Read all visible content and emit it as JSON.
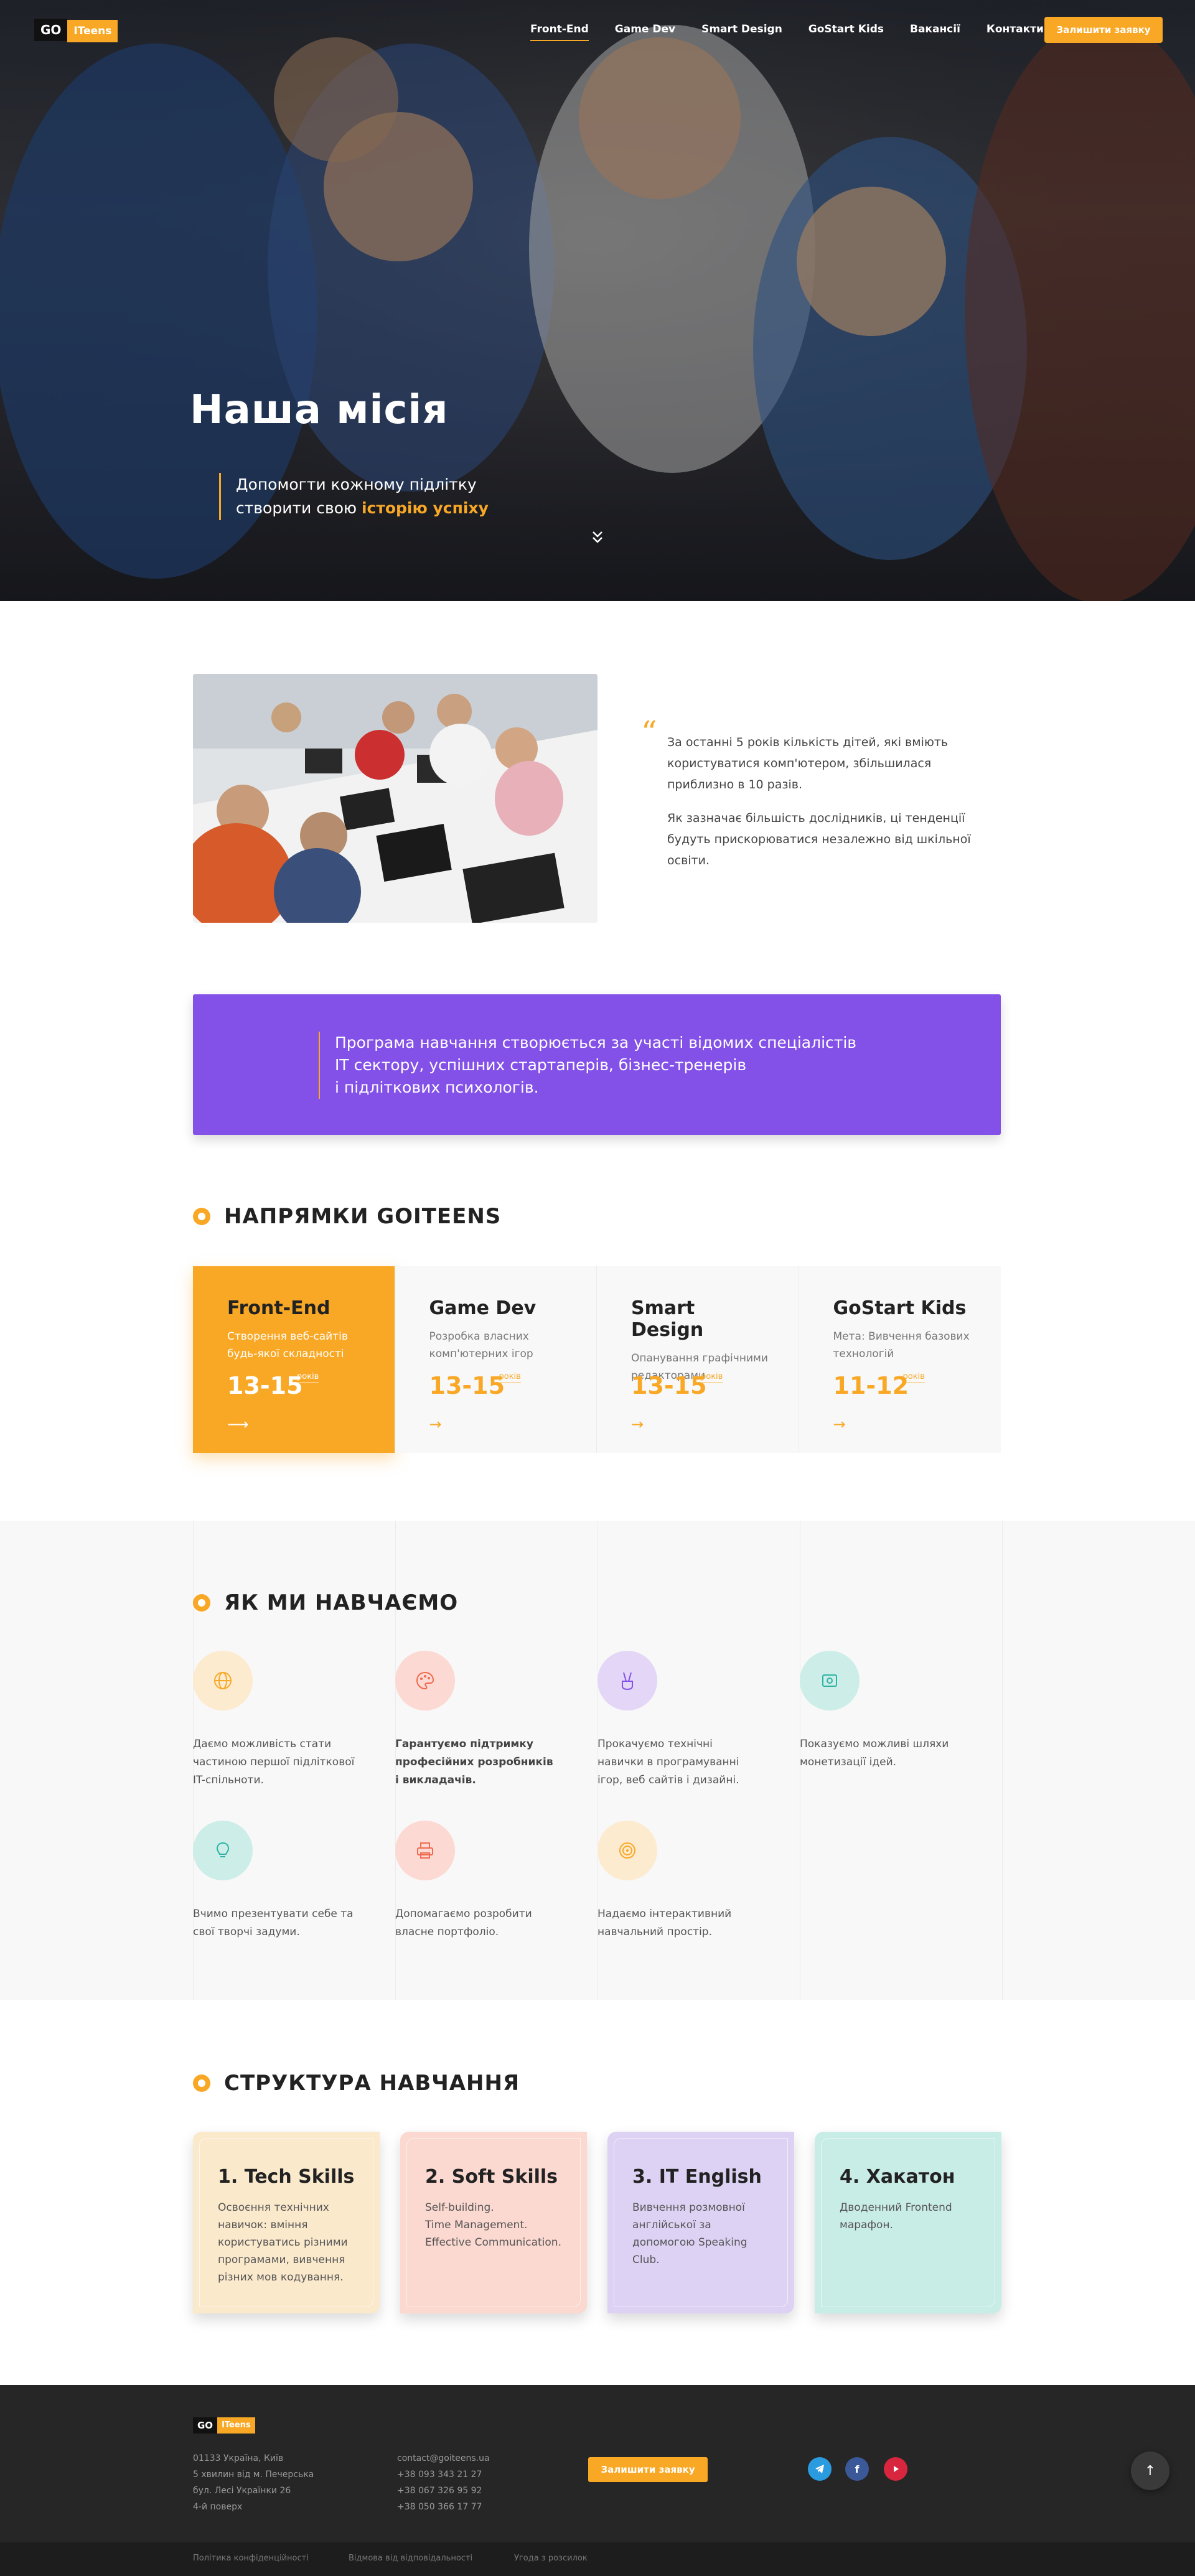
{
  "nav": {
    "logo_go": "GO",
    "logo_teens": "ITeens",
    "items": [
      {
        "label": "Front-End"
      },
      {
        "label": "Game Dev"
      },
      {
        "label": "Smart Design"
      },
      {
        "label": "GoStart Kids"
      },
      {
        "label": "Вакансії"
      },
      {
        "label": "Контакти"
      }
    ],
    "active_index": 0,
    "cta": "Залишити заявку"
  },
  "hero": {
    "title": "Наша місія",
    "subtitle_line1": "Допомогти кожному підлітку",
    "subtitle_line2_start": "створити свою ",
    "subtitle_highlight": "історію успіху",
    "scroll_icon": "chevron-double-down-icon"
  },
  "about": {
    "paragraph1": "За останні 5 років кількість дітей, які вміють користуватися комп'ютером, збільшилася приблизно в 10 разів.",
    "paragraph2": "Як зазначає більшість дослідників, ці тенденції будуть прискорюватися незалежно від шкільної освіти."
  },
  "banner": {
    "text_line1": "Програма навчання створюється за участі відомих спеціалістів",
    "text_line2": "IT сектору, успішних стартаперів, бізнес-тренерів",
    "text_line3": "і підліткових психологів."
  },
  "directions": {
    "heading": "НАПРЯМКИ GOITEENS",
    "cards": [
      {
        "title": "Front-End",
        "desc": "Створення веб-сайтів будь-якої складності",
        "age": "13-15",
        "unit": "років"
      },
      {
        "title": "Game Dev",
        "desc": "Розробка власних комп'ютерних ігор",
        "age": "13-15",
        "unit": "років"
      },
      {
        "title": "Smart Design",
        "desc": "Опанування графічними редакторами",
        "age": "13-15",
        "unit": "років"
      },
      {
        "title": "GoStart Kids",
        "desc": "Мета: Вивчення базових технологій",
        "age": "11-12",
        "unit": "років"
      }
    ]
  },
  "teach": {
    "heading": "ЯК МИ НАВЧАЄМО",
    "features": [
      {
        "icon": "globe-icon",
        "text": "Даємо можливість стати частиною першої підліткової IT-спільноти."
      },
      {
        "icon": "palette-icon",
        "text": "Гарантуємо підтримку професійних розробників і викладачів."
      },
      {
        "icon": "victory-hand-icon",
        "text": "Прокачуємо технічні навички в програмуванні ігор, веб сайтів і дизайні."
      },
      {
        "icon": "money-icon",
        "text": "Показуємо можливі шляхи монетизації ідей."
      },
      {
        "icon": "lightbulb-icon",
        "text": "Вчимо презентувати себе та свої творчі задуми."
      },
      {
        "icon": "printer-icon",
        "text": "Допомагаємо розробити власне портфоліо."
      },
      {
        "icon": "target-icon",
        "text": "Надаємо інтерактивний навчальний простір."
      }
    ]
  },
  "structure": {
    "heading": "СТРУКТУРА НАВЧАННЯ",
    "cards": [
      {
        "title": "1. Tech Skills",
        "text": "Освоєння технічних навичок: вміння користуватись різними програмами, вивчення різних мов кодування.",
        "color": "#fbe9cc"
      },
      {
        "title": "2. Soft Skills",
        "text": "Self-building.\nTime Management.\nEffective Communication.",
        "color": "#fbd8d0"
      },
      {
        "title": "3. IT English",
        "text": "Вивчення розмовної англійської за допомогою Speaking Club.",
        "color": "#ddd2f4"
      },
      {
        "title": "4. Хакатон",
        "text": "Дводенний Frontend марафон.",
        "color": "#c8ece6"
      }
    ]
  },
  "footer": {
    "logo_go": "GO",
    "logo_teens": "ITeens",
    "address": [
      "01133 Україна, Київ",
      "5 хвилин від м. Печерська",
      "бул. Лесі Українки 26",
      "4-й поверх"
    ],
    "contacts": [
      "contact@goiteens.ua",
      "+38 093 343 21 27",
      "+38 067 326 95 92",
      "+38 050 366 17 77"
    ],
    "cta": "Залишити заявку",
    "links": [
      "Політика конфіденційності",
      "Відмова від відповідальності",
      "Угода з розсилок"
    ]
  },
  "colors": {
    "accent": "#f9a826",
    "purple": "#8350e8",
    "footer": "#262626"
  }
}
